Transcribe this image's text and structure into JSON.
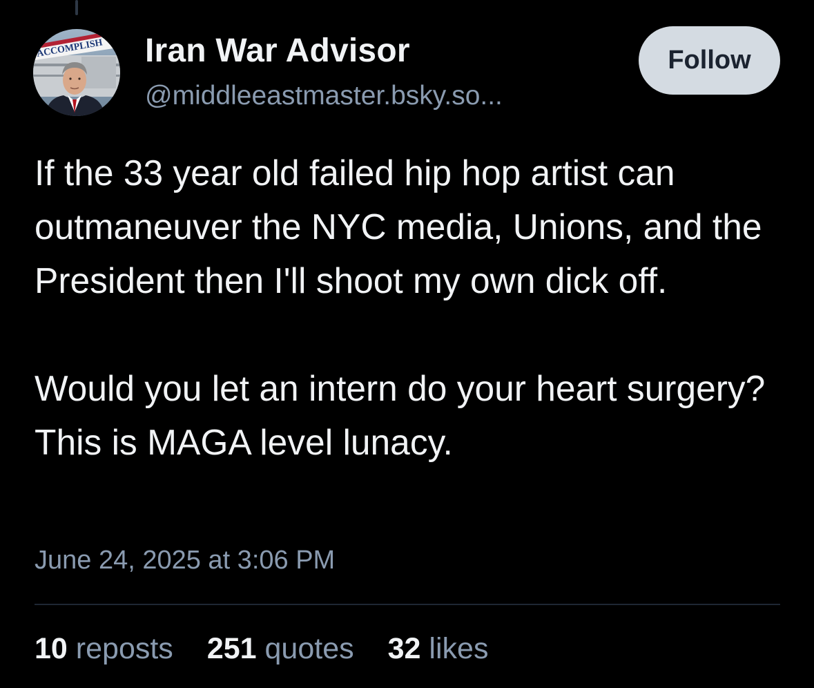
{
  "author": {
    "display_name": "Iran War Advisor",
    "handle": "@middleeastmaster.bsky.so...",
    "avatar_banner_text": "ACCOMPLISH"
  },
  "follow_button": {
    "label": "Follow"
  },
  "post": {
    "paragraphs": [
      "If the 33 year old failed hip hop artist can outmaneuver the NYC media, Unions, and the President then I'll shoot my own dick off.",
      "Would you let an intern do your heart surgery?  This is MAGA level lunacy."
    ],
    "timestamp": "June 24, 2025 at 3:06 PM"
  },
  "stats": {
    "reposts": {
      "count": "10",
      "label": "reposts"
    },
    "quotes": {
      "count": "251",
      "label": "quotes"
    },
    "likes": {
      "count": "32",
      "label": "likes"
    }
  },
  "colors": {
    "background": "#000000",
    "text_primary": "#f1f3f5",
    "text_secondary": "#8a9bb0",
    "follow_button_bg": "#d4dbe2",
    "divider": "#1e2733"
  }
}
